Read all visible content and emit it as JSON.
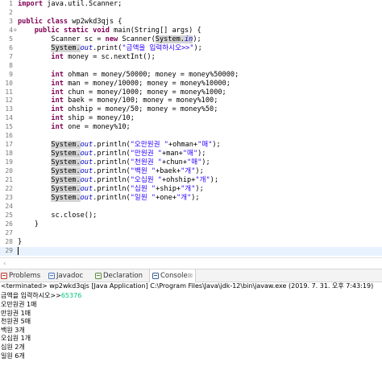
{
  "editor": {
    "lines": [
      {
        "num": "1",
        "fold": "",
        "parts": [
          {
            "t": "import",
            "c": "kw"
          },
          {
            "t": " java.util.Scanner;"
          }
        ]
      },
      {
        "num": "2",
        "fold": "",
        "parts": []
      },
      {
        "num": "3",
        "fold": "",
        "parts": [
          {
            "t": "public",
            "c": "kw"
          },
          {
            "t": " "
          },
          {
            "t": "class",
            "c": "kw"
          },
          {
            "t": " wp2wkd3qjs {"
          }
        ]
      },
      {
        "num": "4",
        "fold": "⊖",
        "parts": [
          {
            "t": "    "
          },
          {
            "t": "public",
            "c": "kw"
          },
          {
            "t": " "
          },
          {
            "t": "static",
            "c": "kw"
          },
          {
            "t": " "
          },
          {
            "t": "void",
            "c": "kw"
          },
          {
            "t": " main(String[] args) {"
          }
        ]
      },
      {
        "num": "5",
        "fold": "",
        "parts": [
          {
            "t": "        Scanner sc = "
          },
          {
            "t": "new",
            "c": "kw"
          },
          {
            "t": " Scanner("
          },
          {
            "t": "System.",
            "c": "sel"
          },
          {
            "t": "in",
            "c": "fld sel"
          },
          {
            "t": ");"
          }
        ]
      },
      {
        "num": "6",
        "fold": "",
        "parts": [
          {
            "t": "        "
          },
          {
            "t": "System.",
            "c": "sel"
          },
          {
            "t": "out",
            "c": "fld"
          },
          {
            "t": ".print("
          },
          {
            "t": "\"금액을 입력하시오>>\"",
            "c": "str"
          },
          {
            "t": ");"
          }
        ]
      },
      {
        "num": "7",
        "fold": "",
        "parts": [
          {
            "t": "        "
          },
          {
            "t": "int",
            "c": "kw"
          },
          {
            "t": " money = sc.nextInt();"
          }
        ]
      },
      {
        "num": "8",
        "fold": "",
        "parts": []
      },
      {
        "num": "9",
        "fold": "",
        "parts": [
          {
            "t": "        "
          },
          {
            "t": "int",
            "c": "kw"
          },
          {
            "t": " ohman = money/50000; money = money%50000;"
          }
        ]
      },
      {
        "num": "10",
        "fold": "",
        "parts": [
          {
            "t": "        "
          },
          {
            "t": "int",
            "c": "kw"
          },
          {
            "t": " man = money/10000; money = money%10000;"
          }
        ]
      },
      {
        "num": "11",
        "fold": "",
        "parts": [
          {
            "t": "        "
          },
          {
            "t": "int",
            "c": "kw"
          },
          {
            "t": " chun = money/1000; money = money%1000;"
          }
        ]
      },
      {
        "num": "12",
        "fold": "",
        "parts": [
          {
            "t": "        "
          },
          {
            "t": "int",
            "c": "kw"
          },
          {
            "t": " baek = money/100; money = money%100;"
          }
        ]
      },
      {
        "num": "13",
        "fold": "",
        "parts": [
          {
            "t": "        "
          },
          {
            "t": "int",
            "c": "kw"
          },
          {
            "t": " ohship = money/50; money = money%50;"
          }
        ]
      },
      {
        "num": "14",
        "fold": "",
        "parts": [
          {
            "t": "        "
          },
          {
            "t": "int",
            "c": "kw"
          },
          {
            "t": " ship = money/10;"
          }
        ]
      },
      {
        "num": "15",
        "fold": "",
        "parts": [
          {
            "t": "        "
          },
          {
            "t": "int",
            "c": "kw"
          },
          {
            "t": " one = money%10;"
          }
        ]
      },
      {
        "num": "16",
        "fold": "",
        "parts": []
      },
      {
        "num": "17",
        "fold": "",
        "parts": [
          {
            "t": "        "
          },
          {
            "t": "System.",
            "c": "sel"
          },
          {
            "t": "out",
            "c": "fld"
          },
          {
            "t": ".println("
          },
          {
            "t": "\"오만원권 \"",
            "c": "str"
          },
          {
            "t": "+ohman+"
          },
          {
            "t": "\"매\"",
            "c": "str"
          },
          {
            "t": ");"
          }
        ]
      },
      {
        "num": "18",
        "fold": "",
        "parts": [
          {
            "t": "        "
          },
          {
            "t": "System.",
            "c": "sel"
          },
          {
            "t": "out",
            "c": "fld"
          },
          {
            "t": ".println("
          },
          {
            "t": "\"만원권 \"",
            "c": "str"
          },
          {
            "t": "+man+"
          },
          {
            "t": "\"매\"",
            "c": "str"
          },
          {
            "t": ");"
          }
        ]
      },
      {
        "num": "19",
        "fold": "",
        "parts": [
          {
            "t": "        "
          },
          {
            "t": "System.",
            "c": "sel"
          },
          {
            "t": "out",
            "c": "fld"
          },
          {
            "t": ".println("
          },
          {
            "t": "\"천원권 \"",
            "c": "str"
          },
          {
            "t": "+chun+"
          },
          {
            "t": "\"매\"",
            "c": "str"
          },
          {
            "t": ");"
          }
        ]
      },
      {
        "num": "20",
        "fold": "",
        "parts": [
          {
            "t": "        "
          },
          {
            "t": "System.",
            "c": "sel"
          },
          {
            "t": "out",
            "c": "fld"
          },
          {
            "t": ".println("
          },
          {
            "t": "\"백원 \"",
            "c": "str"
          },
          {
            "t": "+baek+"
          },
          {
            "t": "\"개\"",
            "c": "str"
          },
          {
            "t": ");"
          }
        ]
      },
      {
        "num": "21",
        "fold": "",
        "parts": [
          {
            "t": "        "
          },
          {
            "t": "System.",
            "c": "sel"
          },
          {
            "t": "out",
            "c": "fld"
          },
          {
            "t": ".println("
          },
          {
            "t": "\"오십원 \"",
            "c": "str"
          },
          {
            "t": "+ohship+"
          },
          {
            "t": "\"개\"",
            "c": "str"
          },
          {
            "t": ");"
          }
        ]
      },
      {
        "num": "22",
        "fold": "",
        "parts": [
          {
            "t": "        "
          },
          {
            "t": "System.",
            "c": "sel"
          },
          {
            "t": "out",
            "c": "fld"
          },
          {
            "t": ".println("
          },
          {
            "t": "\"십원 \"",
            "c": "str"
          },
          {
            "t": "+ship+"
          },
          {
            "t": "\"개\"",
            "c": "str"
          },
          {
            "t": ");"
          }
        ]
      },
      {
        "num": "23",
        "fold": "",
        "parts": [
          {
            "t": "        "
          },
          {
            "t": "System.",
            "c": "sel"
          },
          {
            "t": "out",
            "c": "fld"
          },
          {
            "t": ".println("
          },
          {
            "t": "\"일원 \"",
            "c": "str"
          },
          {
            "t": "+one+"
          },
          {
            "t": "\"개\"",
            "c": "str"
          },
          {
            "t": ");"
          }
        ]
      },
      {
        "num": "24",
        "fold": "",
        "parts": []
      },
      {
        "num": "25",
        "fold": "",
        "parts": [
          {
            "t": "        sc.close();"
          }
        ]
      },
      {
        "num": "26",
        "fold": "",
        "parts": [
          {
            "t": "    }"
          }
        ]
      },
      {
        "num": "27",
        "fold": "",
        "parts": []
      },
      {
        "num": "28",
        "fold": "",
        "parts": [
          {
            "t": "}"
          }
        ]
      },
      {
        "num": "29",
        "fold": "",
        "parts": [],
        "current": true
      }
    ]
  },
  "views": {
    "tabs": [
      {
        "label": "Problems",
        "icon": "problems-icon",
        "name": "tab-problems",
        "active": false
      },
      {
        "label": "Javadoc",
        "icon": "javadoc-icon",
        "name": "tab-javadoc",
        "active": false
      },
      {
        "label": "Declaration",
        "icon": "declaration-icon",
        "name": "tab-declaration",
        "active": false
      },
      {
        "label": "Console",
        "icon": "console-icon",
        "name": "tab-console",
        "active": true,
        "close": "☒"
      }
    ]
  },
  "console": {
    "header": "<terminated> wp2wkd3qjs [Java Application] C:\\Program Files\\Java\\jdk-12\\bin\\javaw.exe (2019. 7. 31. 오후 7:43:19)",
    "prompt": "금액을 입력하시오>>",
    "input": "65376",
    "output": [
      "오만원권 1매",
      "만원권 1매",
      "천원권 5매",
      "백원 3개",
      "오십원 1개",
      "십원 2개",
      "일원 6개"
    ]
  },
  "colors": {
    "keyword": "#7f0055",
    "string": "#2a00ff",
    "field": "#0000c0",
    "selection": "#d4d4d4",
    "console_input": "#00c87d",
    "current_line": "#e8f2fe"
  }
}
